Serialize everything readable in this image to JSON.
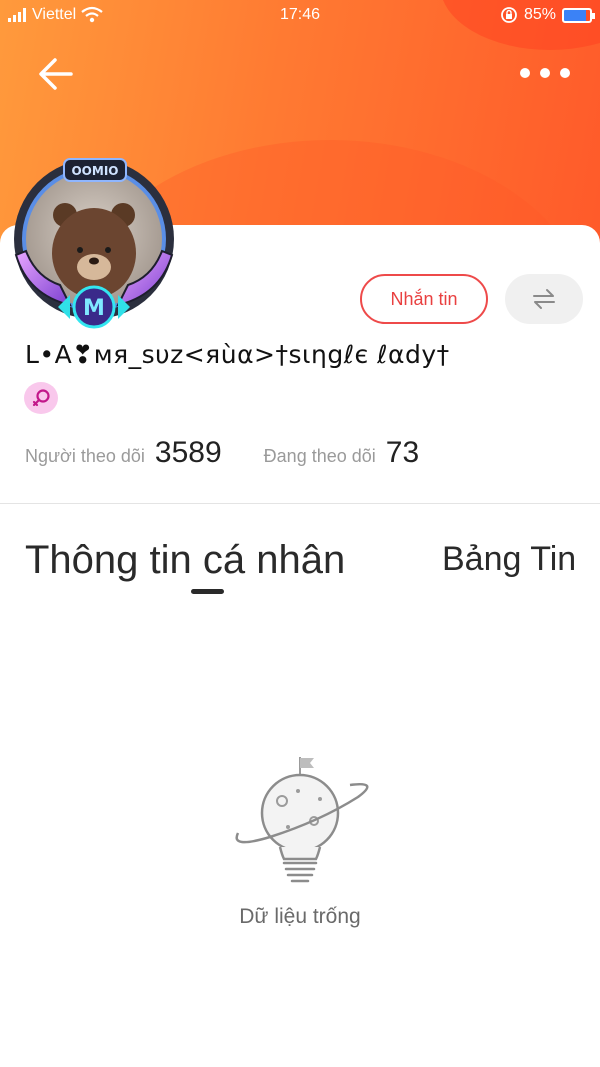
{
  "status_bar": {
    "carrier": "Viettel",
    "network": "4G",
    "time": "17:46",
    "battery": "85%",
    "battery_level": 0.85
  },
  "header": {
    "back_icon": "arrow-left-icon",
    "more_icon": "more-horizontal-icon"
  },
  "profile": {
    "avatar_frame_label": "OOMIO",
    "avatar_badge_letter": "M",
    "username": "L•A❣мя_sυz<яùα>†sιηgℓє ℓαdу†",
    "gender_icon": "female-icon",
    "message_button": "Nhắn tin",
    "swap_icon": "swap-arrows-icon"
  },
  "stats": {
    "followers_label": "Người theo dõi",
    "followers_value": "3589",
    "following_label": "Đang theo dõi",
    "following_value": "73"
  },
  "tabs": {
    "info": "Thông tin cá nhân",
    "feed": "Bảng Tin"
  },
  "empty_state": {
    "icon": "planet-lightbulb-icon",
    "text": "Dữ liệu trống"
  },
  "colors": {
    "header_gradient_start": "#ff9a3c",
    "header_gradient_end": "#ff5a2a",
    "accent_red": "#e94040",
    "gender_badge": "#f9c8ec"
  }
}
